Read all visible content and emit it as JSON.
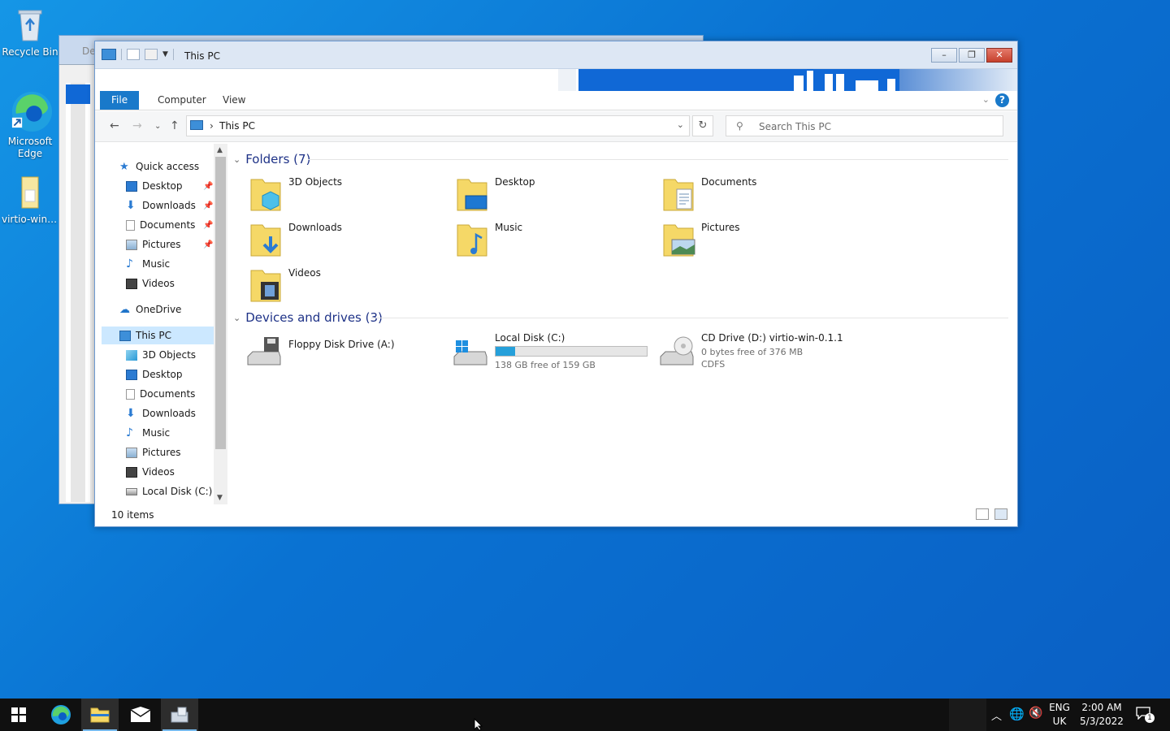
{
  "desktop": {
    "icons": [
      {
        "label": "Recycle Bin"
      },
      {
        "label": "Microsoft Edge"
      },
      {
        "label": "virtio-win-0..."
      }
    ]
  },
  "background_window": {
    "title": "De"
  },
  "window": {
    "title": "This PC",
    "tabs": [
      {
        "label": "File"
      },
      {
        "label": "Computer"
      },
      {
        "label": "View"
      }
    ],
    "help_label": "?",
    "address": {
      "crumb_sep": "›",
      "path": "This PC"
    },
    "search": {
      "placeholder": "Search This PC"
    },
    "nav": [
      {
        "label": "Quick access"
      },
      {
        "label": "Desktop"
      },
      {
        "label": "Downloads"
      },
      {
        "label": "Documents"
      },
      {
        "label": "Pictures"
      },
      {
        "label": "Music"
      },
      {
        "label": "Videos"
      },
      {
        "label": "OneDrive"
      },
      {
        "label": "This PC"
      },
      {
        "label": "3D Objects"
      },
      {
        "label": "Desktop"
      },
      {
        "label": "Documents"
      },
      {
        "label": "Downloads"
      },
      {
        "label": "Music"
      },
      {
        "label": "Pictures"
      },
      {
        "label": "Videos"
      },
      {
        "label": "Local Disk (C:)"
      }
    ],
    "folders_header": "Folders (7)",
    "folders": [
      {
        "label": "3D Objects"
      },
      {
        "label": "Desktop"
      },
      {
        "label": "Documents"
      },
      {
        "label": "Downloads"
      },
      {
        "label": "Music"
      },
      {
        "label": "Pictures"
      },
      {
        "label": "Videos"
      }
    ],
    "devices_header": "Devices and drives (3)",
    "drives": [
      {
        "name": "Floppy Disk Drive (A:)"
      },
      {
        "name": "Local Disk (C:)",
        "free": "138 GB free of 159 GB",
        "used_fraction": 0.13
      },
      {
        "name": "CD Drive (D:) virtio-win-0.1.1",
        "free": "0 bytes free of 376 MB",
        "fs": "CDFS"
      }
    ],
    "status": "10 items"
  },
  "taskbar": {
    "lang_top": "ENG",
    "lang_bottom": "UK",
    "time": "2:00 AM",
    "date": "5/3/2022",
    "notification_count": "1"
  },
  "colors": {
    "accent": "#1979ca",
    "desktop": "#0a72d2",
    "progress": "#26a0da"
  }
}
